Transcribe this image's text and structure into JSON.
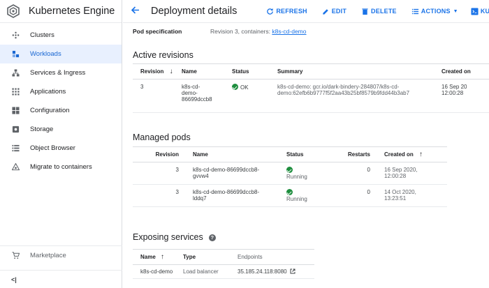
{
  "sidebar": {
    "title": "Kubernetes Engine",
    "items": [
      {
        "label": "Clusters"
      },
      {
        "label": "Workloads"
      },
      {
        "label": "Services & Ingress"
      },
      {
        "label": "Applications"
      },
      {
        "label": "Configuration"
      },
      {
        "label": "Storage"
      },
      {
        "label": "Object Browser"
      },
      {
        "label": "Migrate to containers"
      }
    ],
    "marketplace": "Marketplace",
    "collapse": "<|"
  },
  "header": {
    "title": "Deployment details",
    "refresh": "REFRESH",
    "edit": "EDIT",
    "delete": "DELETE",
    "actions": "ACTIONS",
    "kubectl": "KUBECTL"
  },
  "pod_spec": {
    "label": "Pod specification",
    "value": "Revision 3, containers: ",
    "link": "k8s-cd-demo"
  },
  "active_revisions": {
    "title": "Active revisions",
    "columns": [
      "Revision",
      "Name",
      "Status",
      "Summary",
      "Created on"
    ],
    "rows": [
      {
        "revision": "3",
        "name_lines": [
          "k8s-cd-",
          "demo-",
          "86699dccb8"
        ],
        "status": "OK",
        "summary_lines": [
          "k8s-cd-demo: gcr.io/dark-bindery-284807/k8s-cd-",
          "demo:62efb6b9777f5f2aa43b25bf8579b9fdd44b3ab7"
        ],
        "created_lines": [
          "16 Sep 20",
          "12:00:28"
        ]
      }
    ]
  },
  "managed_pods": {
    "title": "Managed pods",
    "columns": [
      "Revision",
      "Name",
      "Status",
      "Restarts",
      "Created on"
    ],
    "rows": [
      {
        "revision": "3",
        "name_lines": [
          "k8s-cd-demo-86699dccb8-",
          "gvvw4"
        ],
        "status": "Running",
        "restarts": "0",
        "created_lines": [
          "16 Sep 2020,",
          "12:00:28"
        ]
      },
      {
        "revision": "3",
        "name_lines": [
          "k8s-cd-demo-86699dccb8-",
          "lddq7"
        ],
        "status": "Running",
        "restarts": "0",
        "created_lines": [
          "14 Oct 2020,",
          "13:23:51"
        ]
      }
    ]
  },
  "exposing_services": {
    "title": "Exposing services",
    "columns": [
      "Name",
      "Type",
      "Endpoints"
    ],
    "rows": [
      {
        "name": "k8s-cd-demo",
        "type": "Load balancer",
        "endpoint": "35.185.24.118:8080"
      }
    ]
  },
  "colors": {
    "accent": "#1a73e8",
    "ok": "#1e8e3e",
    "active_bg": "#e8f0fe"
  }
}
